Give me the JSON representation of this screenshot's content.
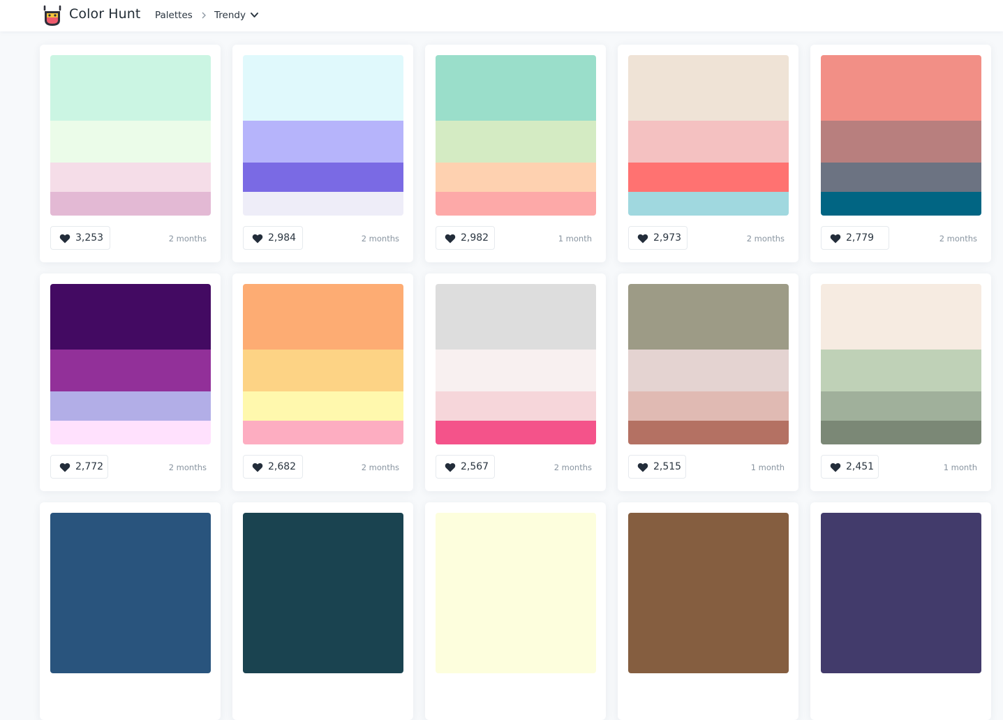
{
  "header": {
    "brand": "Color Hunt",
    "nav_palettes": "Palettes",
    "nav_trendy": "Trendy",
    "logo_colors": [
      "#f4c43a",
      "#ee5a6c",
      "#2d2f3a"
    ]
  },
  "palettes": [
    {
      "likes": "3,253",
      "date": "2 months",
      "colors": [
        "#cbf5e3",
        "#ebfce9",
        "#f5dde8",
        "#e3b9d4"
      ]
    },
    {
      "likes": "2,984",
      "date": "2 months",
      "colors": [
        "#e0f9fc",
        "#b6b4fb",
        "#7a6ae4",
        "#eeedf8"
      ]
    },
    {
      "likes": "2,982",
      "date": "1 month",
      "colors": [
        "#9adeca",
        "#d4ebc3",
        "#fed1b0",
        "#fda9a8"
      ]
    },
    {
      "likes": "2,973",
      "date": "2 months",
      "colors": [
        "#efe3d6",
        "#f4c1c1",
        "#ff7271",
        "#a0d8df"
      ]
    },
    {
      "likes": "2,779",
      "date": "2 months",
      "colors": [
        "#f28f86",
        "#b87f7e",
        "#6c7382",
        "#016583"
      ]
    },
    {
      "likes": "2,772",
      "date": "2 months",
      "colors": [
        "#430a62",
        "#923099",
        "#b2aee7",
        "#ffe1fd"
      ]
    },
    {
      "likes": "2,682",
      "date": "2 months",
      "colors": [
        "#fdac73",
        "#fdd385",
        "#fff8ad",
        "#fdadc1"
      ]
    },
    {
      "likes": "2,567",
      "date": "2 months",
      "colors": [
        "#dddddd",
        "#f8f0f0",
        "#f6d6da",
        "#f4538a"
      ]
    },
    {
      "likes": "2,515",
      "date": "1 month",
      "colors": [
        "#9d9b86",
        "#e4d3d1",
        "#e0bab3",
        "#b47163"
      ]
    },
    {
      "likes": "2,451",
      "date": "1 month",
      "colors": [
        "#f6ebe1",
        "#bfd1b7",
        "#a0b09b",
        "#7b8876"
      ]
    },
    {
      "likes": "",
      "date": "",
      "colors": [
        "#29547d",
        "#29547d",
        "#29547d",
        "#29547d"
      ]
    },
    {
      "likes": "",
      "date": "",
      "colors": [
        "#1a4350",
        "#1a4350",
        "#1a4350",
        "#1a4350"
      ]
    },
    {
      "likes": "",
      "date": "",
      "colors": [
        "#fdfedd",
        "#fdfedd",
        "#fdfedd",
        "#fdfedd"
      ]
    },
    {
      "likes": "",
      "date": "",
      "colors": [
        "#855e40",
        "#855e40",
        "#855e40",
        "#855e40"
      ]
    },
    {
      "likes": "",
      "date": "",
      "colors": [
        "#423b6b",
        "#423b6b",
        "#423b6b",
        "#423b6b"
      ]
    }
  ]
}
